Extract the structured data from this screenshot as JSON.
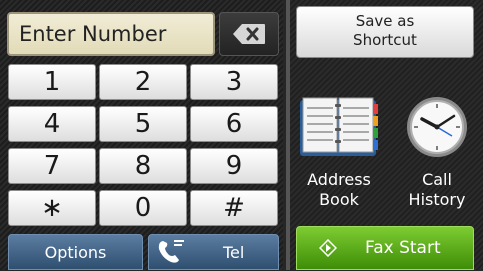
{
  "number_entry": {
    "placeholder": "Enter Number"
  },
  "keypad": {
    "keys": [
      "1",
      "2",
      "3",
      "4",
      "5",
      "6",
      "7",
      "8",
      "9",
      "∗",
      "0",
      "#"
    ]
  },
  "bottom_bar": {
    "options_label": "Options",
    "tel_label": "Tel"
  },
  "right_panel": {
    "save_shortcut_line1": "Save as",
    "save_shortcut_line2": "Shortcut",
    "address_book_line1": "Address",
    "address_book_line2": "Book",
    "call_history_line1": "Call",
    "call_history_line2": "History",
    "fax_start_label": "Fax Start"
  },
  "colors": {
    "display_bg": "#e9e3c6",
    "accent_blue": "#3d5f82",
    "fax_green": "#5aa81c"
  },
  "icons": [
    "backspace-icon",
    "phone-handset-icon",
    "address-book-icon",
    "clock-icon",
    "start-diamond-icon"
  ]
}
